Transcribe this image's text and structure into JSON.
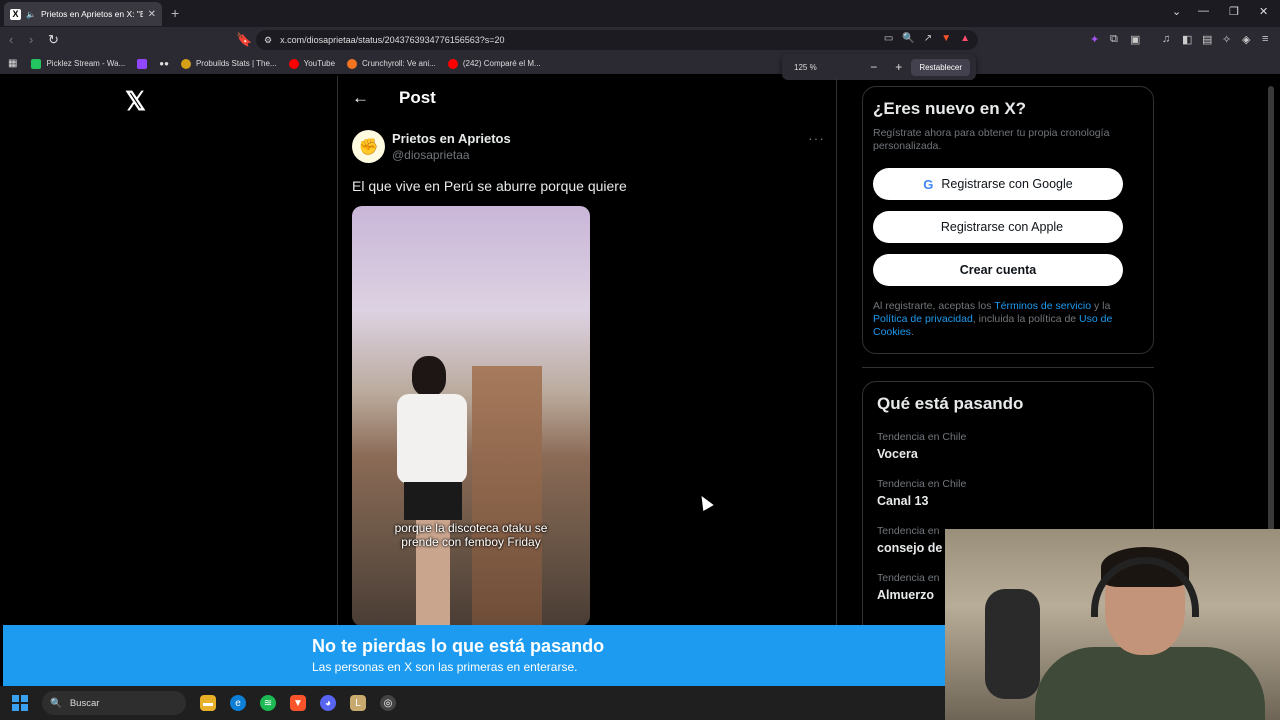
{
  "browser": {
    "tab_title": "Prietos en Aprietos en X: \"El q",
    "tab_favicon": "X",
    "url": "x.com/diosaprietaa/status/2043763934776156563?s=20",
    "bookmarks": [
      {
        "label": "Picklez Stream - Wa...",
        "color": "#22c55e"
      },
      {
        "label": "",
        "color": "#9147ff"
      },
      {
        "label": "",
        "color": "#ffffff"
      },
      {
        "label": "Probuilds Stats | The...",
        "color": "#d4a017"
      },
      {
        "label": "YouTube",
        "color": "#ff0000"
      },
      {
        "label": "Crunchyroll: Ve ani...",
        "color": "#f47521"
      },
      {
        "label": "(242) Comparé el M...",
        "color": "#ff0000"
      }
    ],
    "zoom": {
      "level": "125 %",
      "minus": "−",
      "plus": "+",
      "reset": "Restablecer"
    }
  },
  "page": {
    "header": {
      "back": "←",
      "title": "Post"
    },
    "post": {
      "author_name": "Prietos en Aprietos",
      "author_handle": "@diosaprietaa",
      "more": "···",
      "text": "El que vive en Perú se aburre porque quiere",
      "video_caption_line1": "porque la discoteca otaku se",
      "video_caption_line2": "prende con femboy Friday"
    },
    "signup": {
      "title": "¿Eres nuevo en X?",
      "subtitle": "Regístrate ahora para obtener tu propia cronología personalizada.",
      "google": "Registrarse con Google",
      "apple": "Registrarse con Apple",
      "create": "Crear cuenta",
      "legal_a": "Al registrarte, aceptas los ",
      "legal_terms": "Términos de servicio",
      "legal_b": " y la ",
      "legal_privacy": "Política de privacidad",
      "legal_c": ", incluida la política de ",
      "legal_cookies": "Uso de Cookies",
      "legal_d": "."
    },
    "trends": {
      "title": "Qué está pasando",
      "items": [
        {
          "context": "Tendencia en Chile",
          "name": "Vocera"
        },
        {
          "context": "Tendencia en Chile",
          "name": "Canal 13"
        },
        {
          "context": "Tendencia en",
          "name": "consejo de"
        },
        {
          "context": "Tendencia en",
          "name": "Almuerzo"
        }
      ]
    },
    "banner": {
      "title": "No te pierdas lo que está pasando",
      "subtitle": "Las personas en X son las primeras en enterarse."
    }
  },
  "taskbar": {
    "search_placeholder": "Buscar"
  },
  "colors": {
    "x_blue": "#1d9bf0",
    "background": "#000000"
  }
}
